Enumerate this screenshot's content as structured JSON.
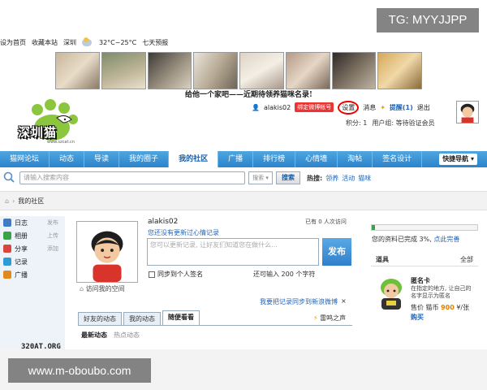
{
  "watermarks": {
    "top": "TG: MYYJJPP",
    "bottom": "www.m-oboubo.com"
  },
  "topbar": {
    "set_home": "设为首页",
    "bookmark": "收藏本站",
    "city": "深圳",
    "temperature": "32°C~25°C",
    "forecast": "七天预报"
  },
  "banner": {
    "slogan": "给他一个家吧——近期待领养猫咪名录!"
  },
  "logo": {
    "text": "深圳猫",
    "url": "www.szcat.cn"
  },
  "userbar": {
    "username": "alakis02",
    "bind_weibo": "绑定微博帐号",
    "settings": "设置",
    "messages": "消息",
    "reminder": "提醒(1)",
    "logout": "退出",
    "points_label": "积分: 1",
    "user_group": "用户组: 等待验证会员"
  },
  "nav": {
    "items": [
      "猫网论坛",
      "动态",
      "导读",
      "我的圈子",
      "我的社区",
      "广播",
      "排行榜",
      "心情墙",
      "淘帖",
      "签名设计"
    ],
    "active": "我的社区",
    "quick": "快捷导航 ▾"
  },
  "search": {
    "placeholder": "请输入搜索内容",
    "type": "搜索 ▾",
    "button": "搜索",
    "hot_label": "热搜:",
    "hot": [
      "领养",
      "活动",
      "猫咪"
    ]
  },
  "breadcrumb": {
    "current": "我的社区"
  },
  "sidebar": {
    "items": [
      {
        "label": "日志",
        "action": "发布",
        "color": "#3d7cc9"
      },
      {
        "label": "相册",
        "action": "上传",
        "color": "#3aa34a"
      },
      {
        "label": "分享",
        "action": "添加",
        "color": "#d9463e"
      },
      {
        "label": "记录",
        "action": "",
        "color": "#2f9bd6"
      },
      {
        "label": "广播",
        "action": "",
        "color": "#e08a1e"
      }
    ]
  },
  "composer": {
    "username": "alakis02",
    "no_mood": "您还没有更新过心情记录",
    "visits": "已有 0 人次访问",
    "placeholder": "您可以更新记录, 让好友们知道您在做什么...",
    "publish": "发布",
    "sync_sign": "同步到个人签名",
    "char_count": "还可输入 200 个字符",
    "sync_weibo": "我要把记录同步到新浪微博",
    "close": "×",
    "visit_space": "访问我的空间"
  },
  "tabs": {
    "items": [
      "好友的动态",
      "我的动态",
      "随便看看"
    ],
    "active": "随便看看",
    "thunder": "雷鸣之声"
  },
  "subtabs": {
    "latest": "最新动态",
    "hot": "热点动态"
  },
  "right_panel": {
    "progress": 0.03,
    "progress_text": "您的资料已完成 3%, ",
    "progress_link": "点此完善",
    "tools_title": "道具",
    "tools_all": "全部",
    "card_name": "匿名卡",
    "card_desc": "在指定的地方, 让自己的名字显示为匿名",
    "card_price_label": "售价 猫币",
    "card_price": "900",
    "card_price_unit": "¥/张",
    "card_buy": "购买"
  },
  "bottom": {
    "text": "320AT.ORG"
  }
}
